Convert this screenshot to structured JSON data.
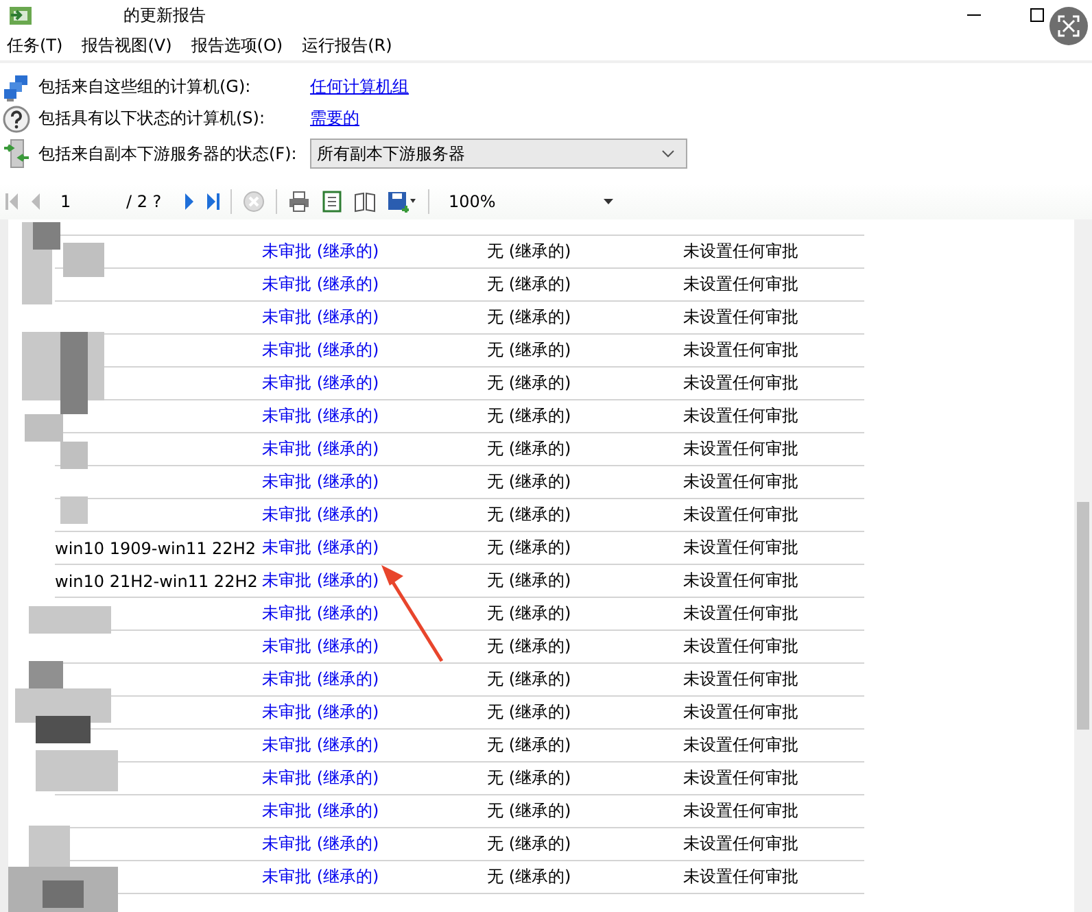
{
  "window": {
    "title": "的更新报告"
  },
  "menu": [
    "任务(T)",
    "报告视图(V)",
    "报告选项(O)",
    "运行报告(R)"
  ],
  "filters": [
    {
      "kind": "link",
      "label": "包括来自这些组的计算机(G):",
      "value": "任何计算机组"
    },
    {
      "kind": "link",
      "label": "包括具有以下状态的计算机(S):",
      "value": "需要的"
    },
    {
      "kind": "select",
      "label": "包括来自副本下游服务器的状态(F):",
      "value": "所有副本下游服务器"
    }
  ],
  "toolbar": {
    "page": "1",
    "page_total": "/ 2 ?",
    "zoom": "100%"
  },
  "rows": [
    {
      "computer": "",
      "approval": "未审批 (继承的)",
      "status": "无 (继承的)",
      "note": "未设置任何审批"
    },
    {
      "computer": "",
      "approval": "未审批 (继承的)",
      "status": "无 (继承的)",
      "note": "未设置任何审批"
    },
    {
      "computer": "",
      "approval": "未审批 (继承的)",
      "status": "无 (继承的)",
      "note": "未设置任何审批"
    },
    {
      "computer": "",
      "approval": "未审批 (继承的)",
      "status": "无 (继承的)",
      "note": "未设置任何审批"
    },
    {
      "computer": "",
      "approval": "未审批 (继承的)",
      "status": "无 (继承的)",
      "note": "未设置任何审批"
    },
    {
      "computer": "",
      "approval": "未审批 (继承的)",
      "status": "无 (继承的)",
      "note": "未设置任何审批"
    },
    {
      "computer": "",
      "approval": "未审批 (继承的)",
      "status": "无 (继承的)",
      "note": "未设置任何审批"
    },
    {
      "computer": "",
      "approval": "未审批 (继承的)",
      "status": "无 (继承的)",
      "note": "未设置任何审批"
    },
    {
      "computer": "",
      "approval": "未审批 (继承的)",
      "status": "无 (继承的)",
      "note": "未设置任何审批"
    },
    {
      "computer": "win10 1909-win11 22H2",
      "approval": "未审批 (继承的)",
      "status": "无 (继承的)",
      "note": "未设置任何审批"
    },
    {
      "computer": "win10 21H2-win11 22H2",
      "approval": "未审批 (继承的)",
      "status": "无 (继承的)",
      "note": "未设置任何审批"
    },
    {
      "computer": "",
      "approval": "未审批 (继承的)",
      "status": "无 (继承的)",
      "note": "未设置任何审批"
    },
    {
      "computer": "",
      "approval": "未审批 (继承的)",
      "status": "无 (继承的)",
      "note": "未设置任何审批"
    },
    {
      "computer": "",
      "approval": "未审批 (继承的)",
      "status": "无 (继承的)",
      "note": "未设置任何审批"
    },
    {
      "computer": "",
      "approval": "未审批 (继承的)",
      "status": "无 (继承的)",
      "note": "未设置任何审批"
    },
    {
      "computer": "",
      "approval": "未审批 (继承的)",
      "status": "无 (继承的)",
      "note": "未设置任何审批"
    },
    {
      "computer": "",
      "approval": "未审批 (继承的)",
      "status": "无 (继承的)",
      "note": "未设置任何审批"
    },
    {
      "computer": "",
      "approval": "未审批 (继承的)",
      "status": "无 (继承的)",
      "note": "未设置任何审批"
    },
    {
      "computer": "",
      "approval": "未审批 (继承的)",
      "status": "无 (继承的)",
      "note": "未设置任何审批"
    },
    {
      "computer": "",
      "approval": "未审批 (继承的)",
      "status": "无 (继承的)",
      "note": "未设置任何审批"
    }
  ]
}
